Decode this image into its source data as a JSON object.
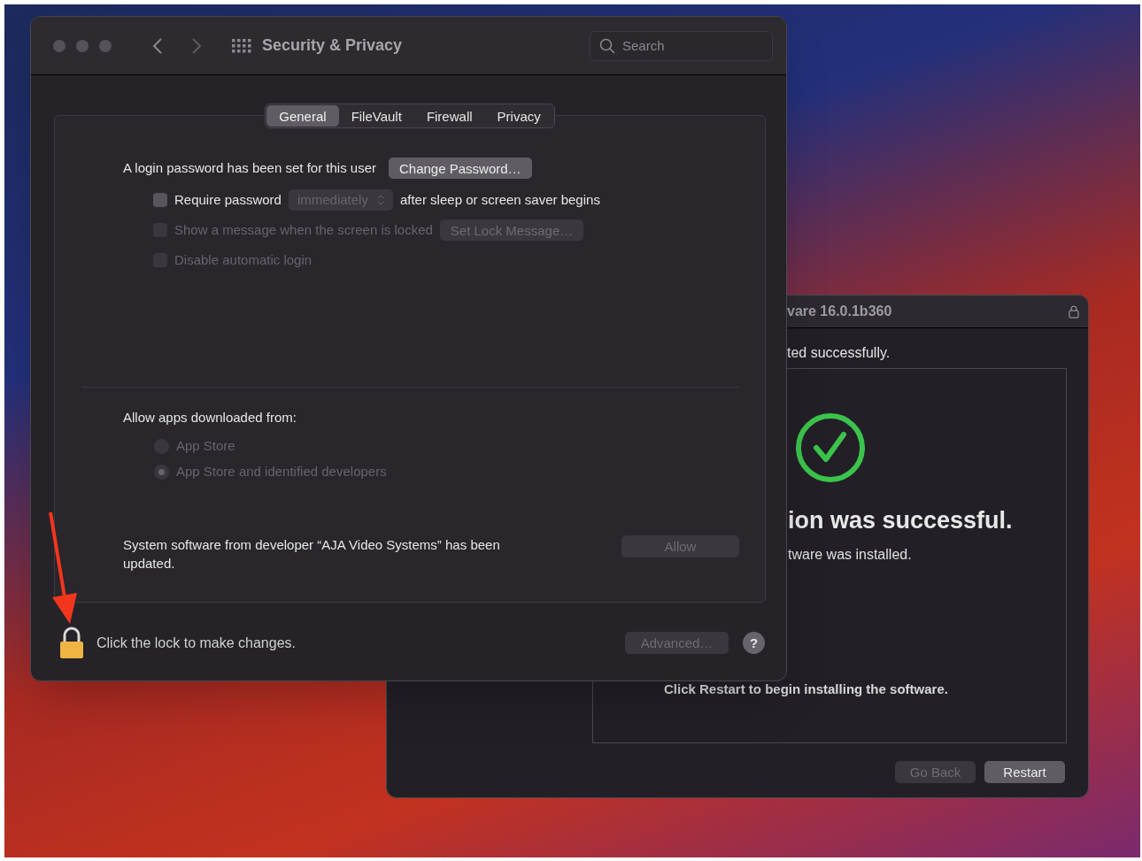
{
  "settings_window": {
    "title": "Security & Privacy",
    "search": {
      "placeholder": "Search"
    },
    "tabs": [
      {
        "label": "General",
        "selected": true
      },
      {
        "label": "FileVault",
        "selected": false
      },
      {
        "label": "Firewall",
        "selected": false
      },
      {
        "label": "Privacy",
        "selected": false
      }
    ],
    "password_text": "A login password has been set for this user",
    "change_password_button": "Change Password…",
    "options": [
      {
        "kind": "select",
        "label": "Require password",
        "checked": false,
        "disabled": false,
        "select": {
          "value": "immediately",
          "disabled": true
        },
        "suffix": "after sleep or screen saver begins"
      },
      {
        "kind": "button",
        "label": "Show a message when the screen is locked",
        "checked": false,
        "disabled": true,
        "button": "Set Lock Message…"
      },
      {
        "kind": "plain",
        "label": "Disable automatic login",
        "checked": false,
        "disabled": true
      }
    ],
    "allow_heading": "Allow apps downloaded from:",
    "sources": [
      {
        "label": "App Store",
        "selected": false,
        "disabled": true
      },
      {
        "label": "App Store and identified developers",
        "selected": true,
        "disabled": true
      }
    ],
    "developer_message": "System software from developer “AJA Video Systems” has been updated.",
    "allow_button": {
      "label": "Allow",
      "disabled": true
    },
    "locked": true,
    "lock_text": "Click the lock to make changes.",
    "advanced_button": {
      "label": "Advanced…",
      "disabled": true
    },
    "help_button": "?"
  },
  "installer_window": {
    "title": "vare 16.0.1b360",
    "status": "ted successfully.",
    "heading": "ion was successful.",
    "subtext": "tware was installed.",
    "instruction": "Click Restart to begin installing the software.",
    "buttons": [
      {
        "label": "Go Back",
        "disabled": true
      },
      {
        "label": "Restart",
        "disabled": false
      }
    ]
  }
}
